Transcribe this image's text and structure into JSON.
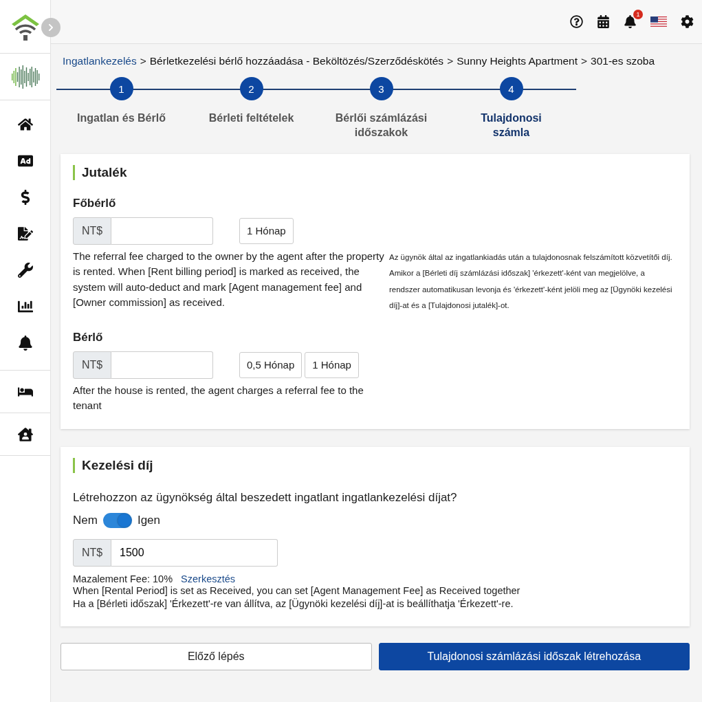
{
  "top_bar": {
    "notification_count": "1"
  },
  "breadcrumb": {
    "separator": ">",
    "items": [
      {
        "label": "Ingatlankezelés",
        "kind": "link"
      },
      {
        "label": "Bérletkezelési bérlő hozzáadása - Beköltözés/Szerződéskötés",
        "kind": "text"
      },
      {
        "label": "Sunny Heights Apartment",
        "kind": "text"
      },
      {
        "label": "301-es szoba",
        "kind": "text"
      }
    ]
  },
  "steps": [
    {
      "number": "1",
      "label": "Ingatlan és Bérlő",
      "selected": false
    },
    {
      "number": "2",
      "label": "Bérleti feltételek",
      "selected": false
    },
    {
      "number": "3",
      "label": "Bérlői számlázási időszakok",
      "selected": false
    },
    {
      "number": "4",
      "label": "Tulajdonosi számla",
      "selected": true
    }
  ],
  "commission": {
    "title": "Jutalék",
    "sections": [
      {
        "label": "Főbérlő",
        "currency": "NT$",
        "presets": [
          "1 Hónap"
        ],
        "description": "The referral fee charged to the owner by the agent after the property is rented. When [Rent billing period] is marked as received, the system will auto-deduct and mark [Agent management fee] and [Owner commission] as received.",
        "description_alt": "Az ügynök által az ingatlankiadás után a tulajdonosnak felszámított közvetítői díj. Amikor a [Bérleti díj számlázási időszak] 'érkezett'-ként van megjelölve, a rendszer automatikusan levonja és 'érkezett'-ként jelöli meg az [Ügynöki kezelési díj]-at és a [Tulajdonosi jutalék]-ot."
      },
      {
        "label": "Bérlő",
        "currency": "NT$",
        "presets": [
          "0,5 Hónap",
          "1 Hónap"
        ],
        "description": "After the house is rented, the agent charges a referral fee to the tenant"
      }
    ]
  },
  "management": {
    "title": "Kezelési díj",
    "question": "Létrehozzon az ügynökség által beszedett ingatlant ingatlankezelési díjat?",
    "toggle": {
      "off_label": "Nem",
      "on_label": "Igen",
      "on": true
    },
    "currency": "NT$",
    "value": "1500",
    "fee_label": "Mazalement Fee: 10%",
    "edit_link": "Szerkesztés",
    "notes": [
      "When [Rental Period] is set as Received, you can set [Agent Management Fee] as Received together",
      "Ha a [Bérleti időszak] 'Érkezett'-re van állítva, az [Ügynöki kezelési díj]-at is beállíthatja 'Érkezett'-re."
    ]
  },
  "buttons": [
    {
      "label": "Előző lépés",
      "kind": "secondary"
    },
    {
      "label": "Tulajdonosi számlázási időszak létrehozása",
      "kind": "primary"
    }
  ]
}
